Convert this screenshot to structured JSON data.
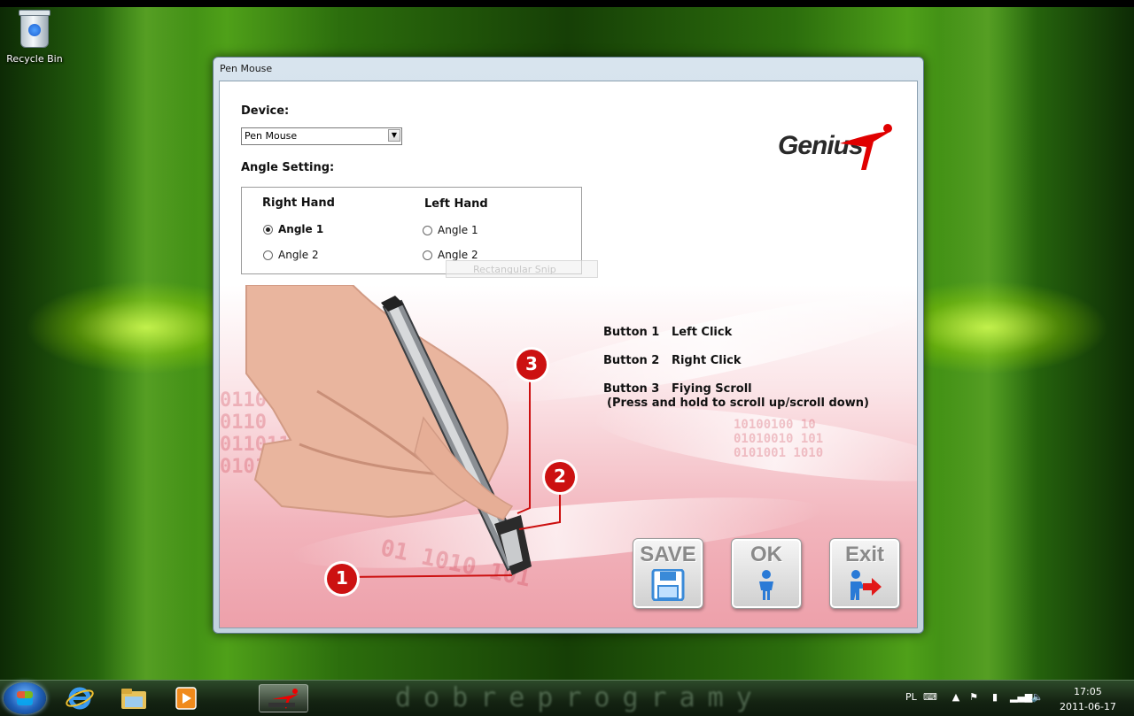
{
  "desktop": {
    "icons": [
      {
        "label": "Recycle Bin",
        "icon": "recycle-bin-icon"
      }
    ]
  },
  "window": {
    "title": "Pen Mouse",
    "device_label": "Device:",
    "device_value": "Pen Mouse",
    "angle_label": "Angle Setting:",
    "right_hand": {
      "title": "Right Hand",
      "options": [
        "Angle 1",
        "Angle 2"
      ],
      "selected": "Angle 1"
    },
    "left_hand": {
      "title": "Left Hand",
      "options": [
        "Angle 1",
        "Angle 2"
      ]
    },
    "snip_overlay": "Rectangular Snip",
    "logo": "Genius",
    "callouts": [
      "1",
      "2",
      "3"
    ],
    "buttons_info": [
      {
        "name": "Button 1",
        "action": "Left Click"
      },
      {
        "name": "Button 2",
        "action": "Right Click"
      },
      {
        "name": "Button 3",
        "action": "Fiying Scroll"
      }
    ],
    "scroll_note": "(Press and hold to scroll up/scroll down)",
    "actions": {
      "save": "SAVE",
      "ok": "OK",
      "exit": "Exit"
    }
  },
  "taskbar": {
    "watermark": "dobreprogramy",
    "language": "PL",
    "time": "17:05",
    "date": "2011-06-17",
    "icons": [
      "start-orb-icon",
      "internet-explorer-icon",
      "explorer-folder-icon",
      "media-player-icon",
      "genius-app-icon"
    ]
  }
}
